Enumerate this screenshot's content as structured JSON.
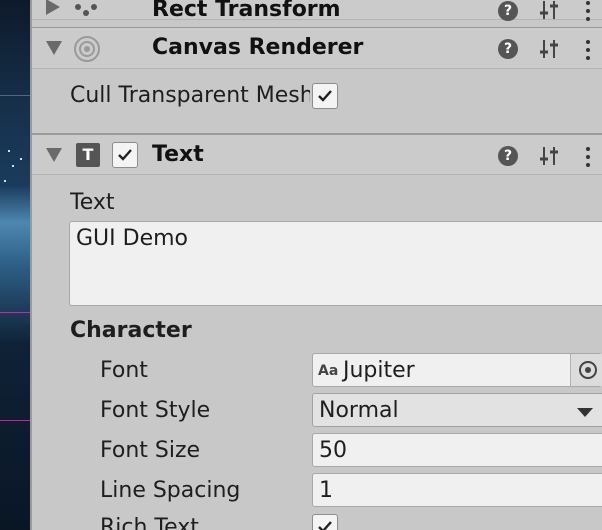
{
  "components": {
    "rect_transform": {
      "title": "Rect Transform"
    },
    "canvas_renderer": {
      "title": "Canvas Renderer",
      "cull_label": "Cull Transparent Mesh",
      "cull_checked": true
    },
    "text": {
      "title": "Text",
      "enabled": true,
      "text_label": "Text",
      "text_value": "GUI Demo",
      "character_heading": "Character",
      "font_label": "Font",
      "font_icon_text": "Aa",
      "font_value": "Jupiter",
      "font_style_label": "Font Style",
      "font_style_value": "Normal",
      "font_size_label": "Font Size",
      "font_size_value": "50",
      "line_spacing_label": "Line Spacing",
      "line_spacing_value": "1",
      "rich_text_label": "Rich Text",
      "rich_text_checked": true
    }
  },
  "help_glyph": "?"
}
